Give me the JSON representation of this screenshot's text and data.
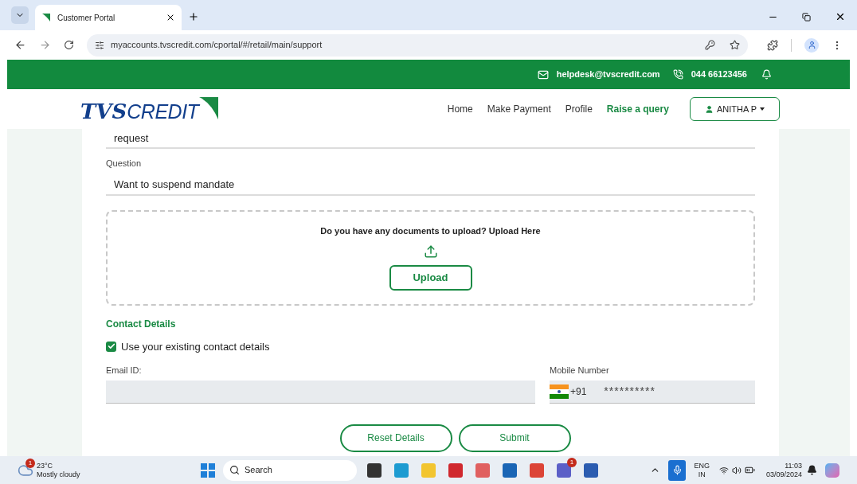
{
  "browser": {
    "tab_title": "Customer Portal",
    "url": "myaccounts.tvscredit.com/cportal/#/retail/main/support"
  },
  "topbar": {
    "email": "helpdesk@tvscredit.com",
    "phone": "044 66123456"
  },
  "header": {
    "logo_tvs": "TVS",
    "logo_credit": "CREDIT",
    "user": "ANITHA P",
    "nav": [
      {
        "label": "Home",
        "selected": false
      },
      {
        "label": "Make Payment",
        "selected": false
      },
      {
        "label": "Profile",
        "selected": false
      },
      {
        "label": "Raise a query",
        "selected": true
      }
    ]
  },
  "form": {
    "subject_value": "request",
    "question_label": "Question",
    "question_value": "Want to suspend mandate",
    "upload_prompt": "Do you have any documents to upload? Upload Here",
    "upload_button": "Upload",
    "contact_heading": "Contact Details",
    "use_existing": {
      "label": "Use your existing contact details",
      "checked": true
    },
    "email_label": "Email ID:",
    "mobile_label": "Mobile Number",
    "country_code": "+91",
    "mobile_value": "**********",
    "buttons": [
      "Reset Details",
      "Submit"
    ]
  },
  "taskbar": {
    "weather_badge": "1",
    "temperature": "23°C",
    "weather": "Mostly cloudy",
    "search_placeholder": "Search",
    "teams_badge": "1",
    "language": "ENG",
    "region": "IN",
    "time": "11:03",
    "date": "03/09/2024"
  }
}
